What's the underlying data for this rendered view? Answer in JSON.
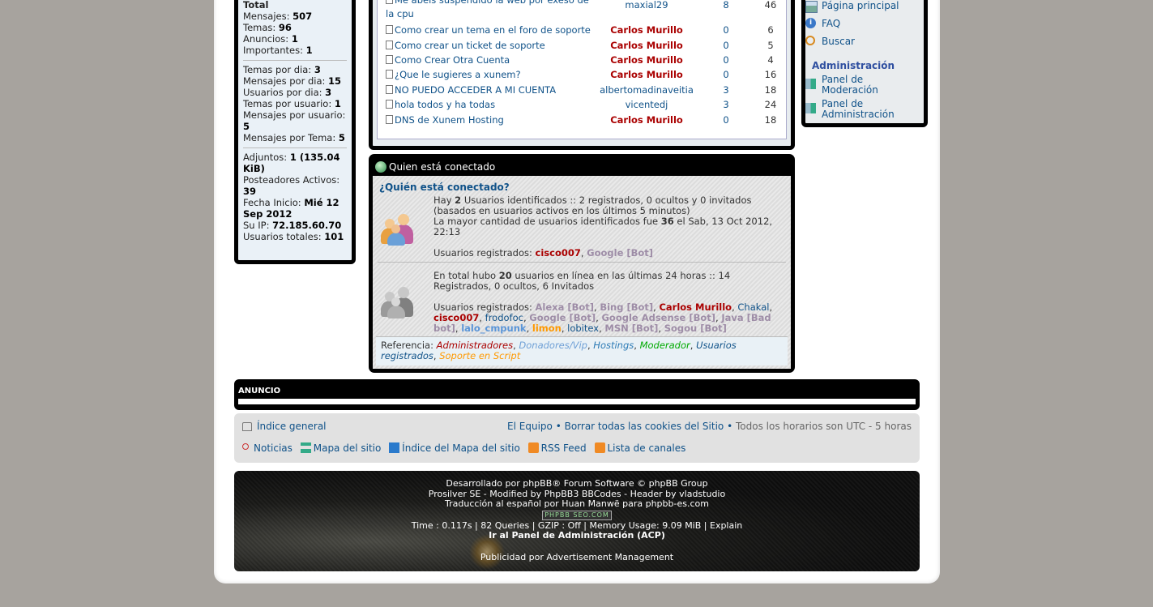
{
  "stats": {
    "partial_top": "Importantes: 1",
    "total_label": "Total",
    "rows1": [
      {
        "k": "Mensajes:",
        "v": "507"
      },
      {
        "k": "Temas:",
        "v": "96"
      },
      {
        "k": "Anuncios:",
        "v": "1"
      },
      {
        "k": "Importantes:",
        "v": "1"
      }
    ],
    "rows2": [
      {
        "k": "Temas por dia:",
        "v": "3"
      },
      {
        "k": "Mensajes por dia:",
        "v": "15"
      },
      {
        "k": "Usuarios por dia:",
        "v": "3"
      },
      {
        "k": "Temas por usuario:",
        "v": "1"
      },
      {
        "k": "Mensajes por usuario:",
        "v": "5"
      },
      {
        "k": "Mensajes por Tema:",
        "v": "5"
      }
    ],
    "rows3": [
      {
        "k": "Adjuntos:",
        "v": "1 (135.04 KiB)"
      },
      {
        "k": "Posteadores Activos:",
        "v": "39"
      },
      {
        "k": "Fecha Inicio:",
        "v": "Mié 12 Sep 2012"
      },
      {
        "k": "Su IP:",
        "v": "72.185.60.70"
      },
      {
        "k": "Usuarios totales:",
        "v": "101"
      }
    ]
  },
  "topics": [
    {
      "title_l1": "Me abeis suspendido la web por exeso de",
      "title_l2": "la cpu",
      "author": "maxial29",
      "author_class": "user",
      "replies": "8",
      "views": "46"
    },
    {
      "title": "Como crear un tema en el foro de soporte",
      "author": "Carlos Murillo",
      "author_class": "mod",
      "replies": "0",
      "views": "6"
    },
    {
      "title": "Como crear un ticket de soporte",
      "author": "Carlos Murillo",
      "author_class": "mod",
      "replies": "0",
      "views": "5"
    },
    {
      "title": "Como Crear Otra Cuenta",
      "author": "Carlos Murillo",
      "author_class": "mod",
      "replies": "0",
      "views": "4"
    },
    {
      "title": "¿Que le sugieres a xunem?",
      "author": "Carlos Murillo",
      "author_class": "mod",
      "replies": "0",
      "views": "16"
    },
    {
      "title": "NO PUEDO ACCEDER A MI CUENTA",
      "author": "albertomadinaveitia",
      "author_class": "user",
      "replies": "3",
      "views": "18"
    },
    {
      "title": "hola todos y ha todas",
      "author": "vicentedj",
      "author_class": "user",
      "replies": "3",
      "views": "24"
    },
    {
      "title": "DNS de Xunem Hosting",
      "author": "Carlos Murillo",
      "author_class": "mod",
      "replies": "0",
      "views": "18"
    }
  ],
  "online": {
    "header": "Quien está conectado",
    "question": "¿Quién está conectado?",
    "now_l1_pre": "Hay ",
    "now_l1_num": "2",
    "now_l1_post": " Usuarios identificados :: 2 registrados, 0 ocultos y 0 invitados",
    "now_l2": "(basados en usuarios activos en los últimos 5 minutos)",
    "now_l3_pre": "La mayor cantidad de usuarios identificados fue ",
    "now_l3_num": "36",
    "now_l3_post": " el Sab, 13 Oct 2012,",
    "now_l4": "22:13",
    "reg_label": "Usuarios registrados: ",
    "reg_users": [
      {
        "n": "cisco007",
        "c": "mod"
      },
      {
        "n": "Google [Bot]",
        "c": "bot"
      }
    ],
    "day_l1_pre": "En total hubo ",
    "day_l1_num": "20",
    "day_l1_post": " usuarios en línea en las últimas 24 horas :: 14",
    "day_l2": "Registrados, 0 ocultos, 6 Invitados",
    "day_label": "Usuarios registrados: ",
    "day_users": [
      {
        "n": "Alexa [Bot]",
        "c": "bot"
      },
      {
        "n": "Bing [Bot]",
        "c": "bot"
      },
      {
        "n": "Carlos Murillo",
        "c": "mod"
      },
      {
        "n": "Chakal",
        "c": "user"
      },
      {
        "n": "cisco007",
        "c": "mod"
      },
      {
        "n": "frodofoc",
        "c": "user"
      },
      {
        "n": "Google [Bot]",
        "c": "bot"
      },
      {
        "n": "Google Adsense [Bot]",
        "c": "bot"
      },
      {
        "n": "Java [Bad bot]",
        "c": "bot"
      },
      {
        "n": "lalo_cmpunk",
        "c": "vipb"
      },
      {
        "n": "limon",
        "c": "sup"
      },
      {
        "n": "lobitex",
        "c": "user"
      },
      {
        "n": "MSN [Bot]",
        "c": "bot"
      },
      {
        "n": "Sogou [Bot]",
        "c": "bot"
      }
    ],
    "legend_label": "Referencia: ",
    "legend": [
      {
        "n": "Administradores",
        "c": "c-admin"
      },
      {
        "n": "Donadores/Vip",
        "c": "c-vip"
      },
      {
        "n": "Hostings",
        "c": "c-host"
      },
      {
        "n": "Moderador",
        "c": "c-modr"
      },
      {
        "n": "Usuarios registrados",
        "c": "c-reg"
      },
      {
        "n": "Soporte en Script",
        "c": "c-sup"
      }
    ]
  },
  "rnav": {
    "home": "Página principal",
    "faq": "FAQ",
    "search": "Buscar",
    "admin_title": "Administración",
    "mod_l1": "Panel de",
    "mod_l2": "Moderación",
    "acp_l1": "Panel de",
    "acp_l2": "Administración"
  },
  "anuncio": {
    "title": "ANUNCIO"
  },
  "navbar": {
    "index": "Índice general",
    "team": "El Equipo",
    "cookies": "Borrar todas las cookies del Sitio",
    "tz": "Todos los horarios son UTC - 5 horas",
    "news": "Noticias",
    "sitemap": "Mapa del sitio",
    "sitemap_index": "Índice del Mapa del sitio",
    "rss": "RSS Feed",
    "channels": "Lista de canales"
  },
  "footer": {
    "l1": "Desarrollado por phpBB® Forum Software © phpBB Group",
    "l2": "Prosilver SE - Modified by PhpBB3 BBCodes - Header by vladstudio",
    "l3": "Traducción al español por Huan Manwë para phpbb-es.com",
    "seo": "PHPBB SEO.COM",
    "l4": "Time : 0.117s | 82 Queries | GZIP : Off | Memory Usage: 9.09 MiB | Explain",
    "l5": "Ir al Panel de Administración (ACP)",
    "l6": "Publicidad por Advertisement Management"
  }
}
